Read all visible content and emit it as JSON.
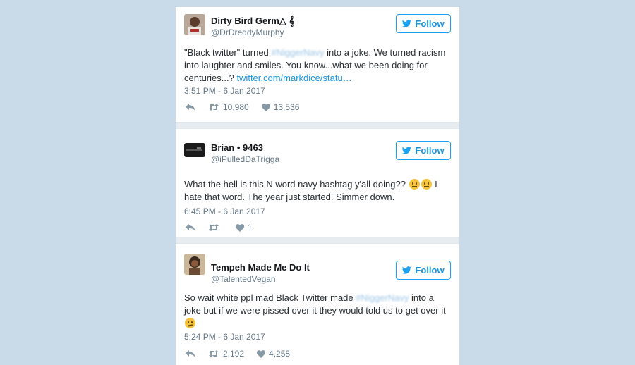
{
  "tweets": [
    {
      "name": "⁠Dirty Bird Germ△ 𝄞",
      "handle": "@DrDreddyMurphy",
      "follow_label": "Follow",
      "text_before": "\"Black twitter\" turned ",
      "hashtag": "#NiggerNavy",
      "text_after": " into a joke. We turned racism into laughter and smiles. You know...what we been doing for centuries...? ",
      "link": "twitter.com/markdice/statu…",
      "timestamp": "3:51 PM - 6 Jan 2017",
      "retweets": "10,980",
      "likes": "13,536"
    },
    {
      "name": "Brian • 9463 ⁠",
      "handle": "@iPulledDaTrigga",
      "follow_label": "Follow",
      "text_before": "What the hell is this N word navy hashtag y'all doing??",
      "text_after": " I hate that word. The year just started. Simmer down.",
      "emojis": [
        "confused-face",
        "confused-face"
      ],
      "timestamp": "6:45 PM - 6 Jan 2017",
      "retweets": "",
      "likes": "1"
    },
    {
      "name": "Tempeh Made Me Do It",
      "handle": "@TalentedVegan",
      "follow_label": "Follow",
      "text_before": "So wait white ppl mad Black Twitter made ",
      "hashtag": "#NiggerNavy",
      "text_after": " into a joke but if we were pissed over it they would told us to get over it",
      "emojis": [
        "thinking-face"
      ],
      "timestamp": "5:24 PM - 6 Jan 2017",
      "retweets": "2,192",
      "likes": "4,258"
    }
  ],
  "colors": {
    "background": "#c9dbe8",
    "accent": "#1da1f2",
    "link": "#1b95e0",
    "muted": "#657786"
  }
}
